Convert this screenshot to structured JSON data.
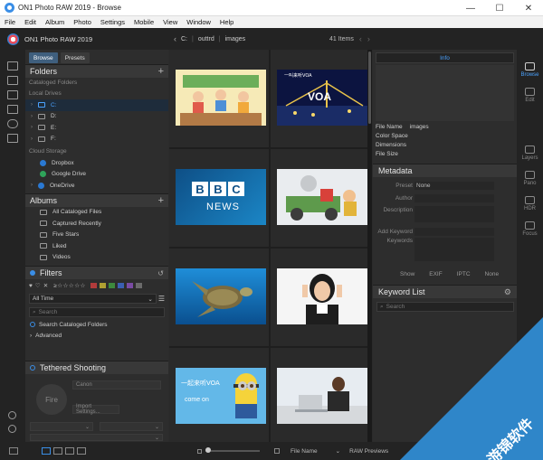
{
  "window": {
    "title": "ON1 Photo RAW 2019 - Browse",
    "minimize": "—",
    "maximize": "☐",
    "close": "✕"
  },
  "menu": [
    "File",
    "Edit",
    "Album",
    "Photo",
    "Settings",
    "Mobile",
    "View",
    "Window",
    "Help"
  ],
  "appbar": {
    "title": "ON1 Photo RAW 2019",
    "path": [
      "C:",
      "outtrd",
      "images"
    ],
    "items_count": "41 Items"
  },
  "left": {
    "tabs": [
      "Browse",
      "Presets"
    ],
    "folders": {
      "title": "Folders",
      "cataloged": "Cataloged Folders",
      "local": "Local Drives",
      "drives": [
        "C:",
        "D:",
        "E:",
        "F:"
      ],
      "cloud": "Cloud Storage",
      "cloud_items": [
        "Dropbox",
        "Google Drive",
        "OneDrive"
      ]
    },
    "albums": {
      "title": "Albums",
      "items": [
        "All Cataloged Files",
        "Captured Recently",
        "Five Stars",
        "Liked",
        "Videos"
      ]
    },
    "filters": {
      "title": "Filters",
      "stars": "≥☆☆☆☆☆",
      "time": "All Time",
      "search_placeholder": "Search",
      "search_cataloged": "Search Cataloged Folders",
      "advanced": "Advanced"
    },
    "tether": {
      "title": "Tethered Shooting",
      "fire": "Fire",
      "camera": "Canon",
      "import": "Import Settings..."
    }
  },
  "grid": {
    "thumbs": [
      {
        "caption": ""
      },
      {
        "caption": "VOA"
      },
      {
        "caption": "BBC NEWS"
      },
      {
        "caption": ""
      },
      {
        "caption": ""
      },
      {
        "caption": ""
      },
      {
        "caption": "一起来听VOA come on"
      },
      {
        "caption": ""
      }
    ],
    "bbc_letters": [
      "B",
      "B",
      "C"
    ],
    "bbc_news": "NEWS",
    "voa_text": "VOA",
    "voa_top": "一叫来听VOA",
    "minion_line1": "一起来听VOA",
    "minion_line2": "come on"
  },
  "right": {
    "info_tab": "Info",
    "info": [
      {
        "k": "File Name",
        "v": "images"
      },
      {
        "k": "Color Space",
        "v": ""
      },
      {
        "k": "Dimensions",
        "v": ""
      },
      {
        "k": "File Size",
        "v": ""
      }
    ],
    "metadata": {
      "title": "Metadata",
      "preset_label": "Preset",
      "preset_value": "None",
      "author": "Author",
      "description": "Description",
      "add_keyword": "Add Keyword",
      "keywords": "Keywords"
    },
    "show": {
      "label": "Show",
      "opts": [
        "EXIF",
        "IPTC",
        "None"
      ]
    },
    "keyword_list": {
      "title": "Keyword List",
      "search_placeholder": "Search"
    }
  },
  "modules": [
    "Browse",
    "Edit",
    "Layers",
    "Pano",
    "HDR",
    "Focus"
  ],
  "bottom": {
    "sort": "File Name",
    "raw": "RAW Previews"
  },
  "watermark": {
    "text": "游锦软件"
  }
}
